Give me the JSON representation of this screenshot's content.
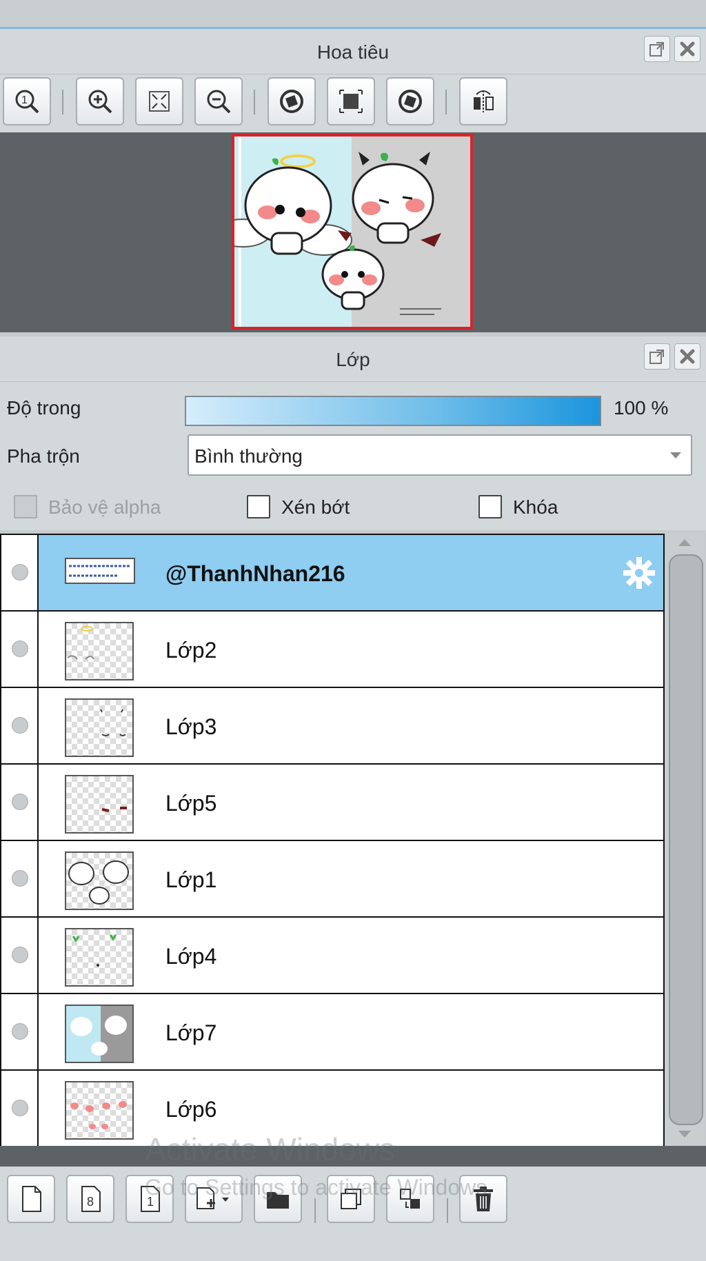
{
  "navigator": {
    "title": "Hoa tiêu",
    "toolbar": [
      "zoom-actual-icon",
      "zoom-in-icon",
      "fit-screen-icon",
      "zoom-out-icon",
      "rotate-left-icon",
      "fit-window-icon",
      "rotate-right-icon",
      "flip-horizontal-icon"
    ]
  },
  "layers_panel": {
    "title": "Lớp",
    "opacity_label": "Độ trong",
    "opacity_value": "100 %",
    "blend_label": "Pha trộn",
    "blend_value": "Bình thường",
    "protect_alpha_label": "Bảo vệ alpha",
    "clipping_label": "Xén bớt",
    "lock_label": "Khóa",
    "layers": [
      {
        "name": "@ThanhNhan216",
        "selected": true
      },
      {
        "name": "Lớp2",
        "selected": false
      },
      {
        "name": "Lớp3",
        "selected": false
      },
      {
        "name": "Lớp5",
        "selected": false
      },
      {
        "name": "Lớp1",
        "selected": false
      },
      {
        "name": "Lớp4",
        "selected": false
      },
      {
        "name": "Lớp7",
        "selected": false
      },
      {
        "name": "Lớp6",
        "selected": false
      }
    ]
  },
  "watermark": {
    "line1": "Activate Windows",
    "line2": "Go to Settings to activate Windows."
  },
  "colors": {
    "selected_row": "#8fcdf1",
    "frame_red": "#d4262a",
    "panel_bg": "#d3d8db"
  }
}
